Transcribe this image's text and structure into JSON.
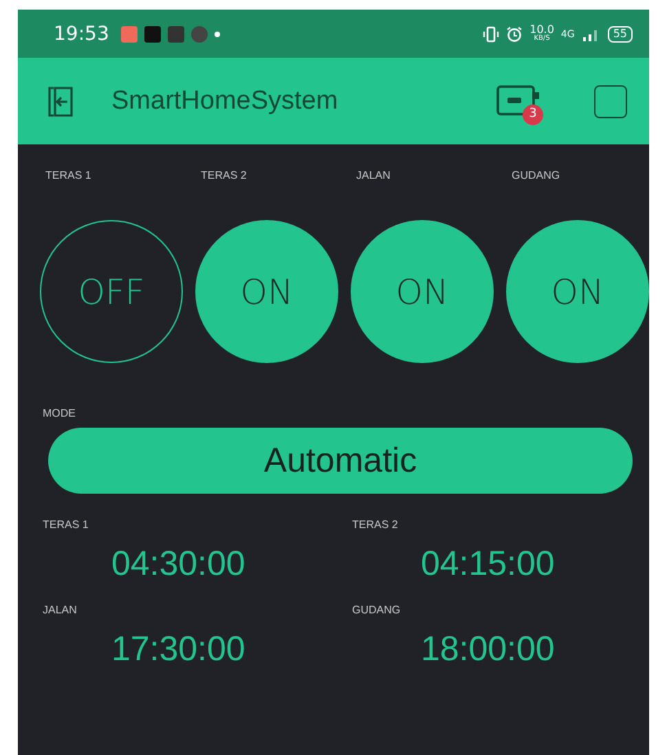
{
  "status_bar": {
    "time": "19:53",
    "speed": "10.0",
    "speed_unit": "KB/S",
    "network": "4G",
    "battery": "55"
  },
  "header": {
    "title": "SmartHomeSystem",
    "badge": "3"
  },
  "switches": [
    {
      "label": "TERAS 1",
      "text": "OFF",
      "on": false
    },
    {
      "label": "TERAS 2",
      "text": "ON",
      "on": true
    },
    {
      "label": "JALAN",
      "text": "ON",
      "on": true
    },
    {
      "label": "GUDANG",
      "text": "ON",
      "on": true
    }
  ],
  "mode": {
    "label": "MODE",
    "value": "Automatic"
  },
  "timers": [
    {
      "label": "TERAS 1",
      "value": "04:30:00"
    },
    {
      "label": "TERAS 2",
      "value": "04:15:00"
    },
    {
      "label": "JALAN",
      "value": "17:30:00"
    },
    {
      "label": "GUDANG",
      "value": "18:00:00"
    }
  ]
}
